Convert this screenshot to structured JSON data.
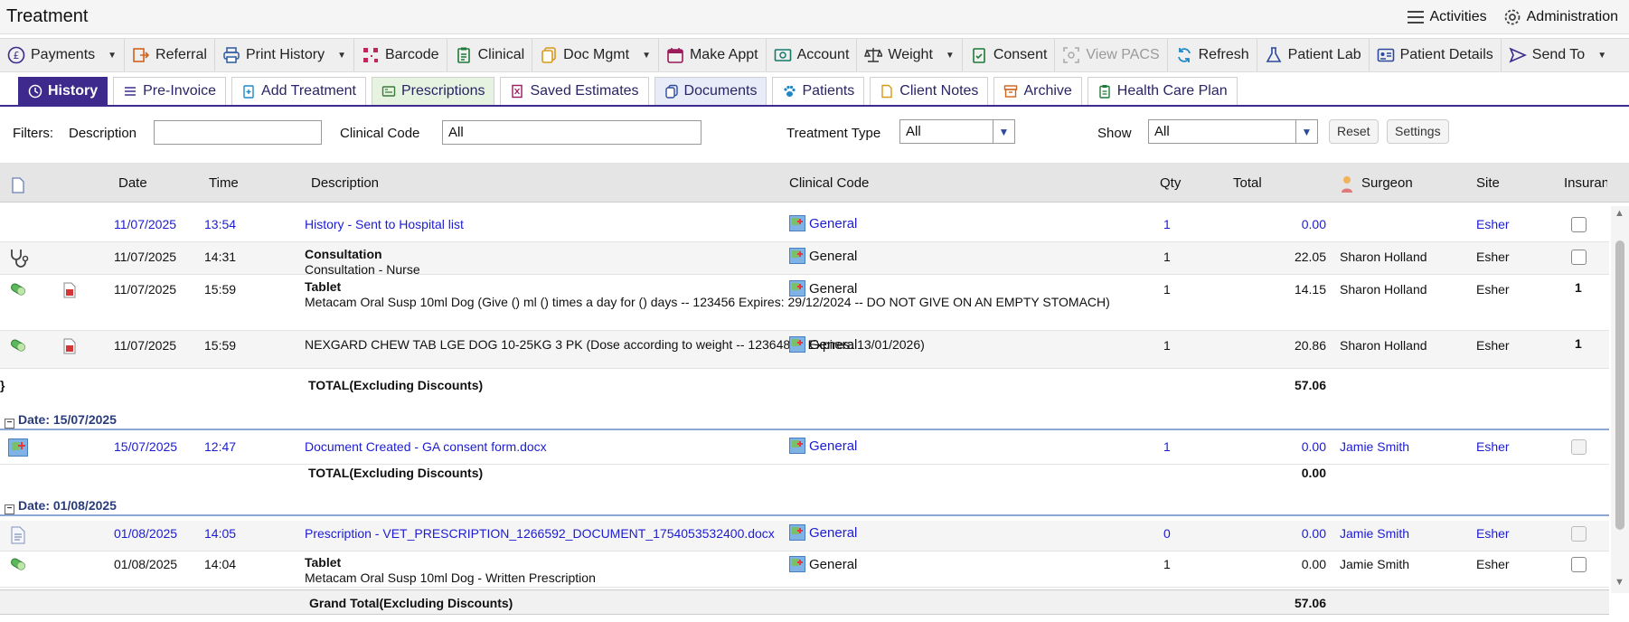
{
  "app": {
    "title": "Treatment",
    "top_actions": [
      {
        "label": "Activities",
        "icon": "list-icon"
      },
      {
        "label": "Administration",
        "icon": "gear-icon"
      }
    ]
  },
  "toolbar": [
    {
      "label": "Payments",
      "icon": "pound-icon",
      "dropdown": true
    },
    {
      "label": "Referral",
      "icon": "referral-icon"
    },
    {
      "label": "Print History",
      "icon": "printer-icon",
      "dropdown": true
    },
    {
      "label": "Barcode",
      "icon": "barcode-icon"
    },
    {
      "label": "Clinical",
      "icon": "clipboard-icon"
    },
    {
      "label": "Doc Mgmt",
      "icon": "documents-icon",
      "dropdown": true
    },
    {
      "label": "Make Appt",
      "icon": "calendar-icon"
    },
    {
      "label": "Account",
      "icon": "money-icon"
    },
    {
      "label": "Weight",
      "icon": "scales-icon",
      "dropdown": true
    },
    {
      "label": "Consent",
      "icon": "clipboard-check-icon"
    },
    {
      "label": "View PACS",
      "icon": "pacs-icon",
      "disabled": true
    },
    {
      "label": "Refresh",
      "icon": "refresh-icon"
    },
    {
      "label": "Patient Lab",
      "icon": "flask-icon"
    },
    {
      "label": "Patient Details",
      "icon": "id-card-icon"
    },
    {
      "label": "Send To",
      "icon": "send-icon",
      "dropdown": true
    }
  ],
  "tabs": [
    {
      "label": "History",
      "active": true
    },
    {
      "label": "Pre-Invoice"
    },
    {
      "label": "Add Treatment"
    },
    {
      "label": "Prescriptions"
    },
    {
      "label": "Saved Estimates"
    },
    {
      "label": "Documents"
    },
    {
      "label": "Patients"
    },
    {
      "label": "Client Notes"
    },
    {
      "label": "Archive"
    },
    {
      "label": "Health Care Plan"
    }
  ],
  "filters": {
    "label": "Filters:",
    "description_label": "Description",
    "description_value": "",
    "clinical_code_label": "Clinical Code",
    "clinical_code_value": "All",
    "treatment_type_label": "Treatment Type",
    "treatment_type_value": "All",
    "show_label": "Show",
    "show_value": "All",
    "reset_label": "Reset",
    "settings_label": "Settings"
  },
  "columns": {
    "date": "Date",
    "time": "Time",
    "description": "Description",
    "clinical_code": "Clinical Code",
    "qty": "Qty",
    "total": "Total",
    "surgeon": "Surgeon",
    "site": "Site",
    "insurance": "Insuranc"
  },
  "groups": [
    {
      "header": "",
      "rows": [
        {
          "date": "11/07/2025",
          "time": "13:54",
          "title": "History - Sent to Hospital list",
          "detail": "",
          "code": "General",
          "qty": "1",
          "total": "0.00",
          "surgeon": "",
          "site": "Esher",
          "insurance": "checkbox",
          "link": true
        },
        {
          "date": "11/07/2025",
          "time": "14:31",
          "title": "Consultation",
          "detail": "Consultation - Nurse",
          "code": "General",
          "qty": "1",
          "total": "22.05",
          "surgeon": "Sharon Holland",
          "site": "Esher",
          "insurance": "checkbox",
          "icon": "stethoscope-icon"
        },
        {
          "date": "11/07/2025",
          "time": "15:59",
          "title": "Tablet",
          "detail": "Metacam Oral Susp 10ml Dog (Give () ml () times a day for () days -- 123456 Expires: 29/12/2024 -- DO NOT GIVE ON AN EMPTY STOMACH)",
          "code": "General",
          "qty": "1",
          "total": "14.15",
          "surgeon": "Sharon Holland",
          "site": "Esher",
          "insurance": "1",
          "icon": "pill-icon"
        },
        {
          "date": "11/07/2025",
          "time": "15:59",
          "title": "",
          "detail": "NEXGARD CHEW TAB LGE DOG 10-25KG 3 PK (Dose according to weight -- 12364888 Expires: 13/01/2026)",
          "code": "General",
          "qty": "1",
          "total": "20.86",
          "surgeon": "Sharon Holland",
          "site": "Esher",
          "insurance": "1",
          "icon": "pill-icon"
        }
      ],
      "total_label": "TOTAL(Excluding Discounts)",
      "total_value": "57.06"
    },
    {
      "header": "Date: 15/07/2025",
      "rows": [
        {
          "date": "15/07/2025",
          "time": "12:47",
          "title": "Document Created - GA consent form.docx",
          "detail": "",
          "code": "General",
          "qty": "1",
          "total": "0.00",
          "surgeon": "Jamie Smith",
          "site": "Esher",
          "insurance": "checkbox",
          "link": true,
          "icon": "document-created-icon"
        }
      ],
      "total_label": "TOTAL(Excluding Discounts)",
      "total_value": "0.00"
    },
    {
      "header": "Date: 01/08/2025",
      "rows": [
        {
          "date": "01/08/2025",
          "time": "14:05",
          "title": "Prescription - VET_PRESCRIPTION_1266592_DOCUMENT_1754053532400.docx",
          "detail": "",
          "code": "General",
          "qty": "0",
          "total": "0.00",
          "surgeon": "Jamie Smith",
          "site": "Esher",
          "insurance": "checkbox",
          "link": true,
          "icon": "document-icon"
        },
        {
          "date": "01/08/2025",
          "time": "14:04",
          "title": "Tablet",
          "detail": "Metacam Oral Susp 10ml Dog - Written Prescription",
          "code": "General",
          "qty": "1",
          "total": "0.00",
          "surgeon": "Jamie Smith",
          "site": "Esher",
          "insurance": "checkbox",
          "icon": "pill-icon"
        }
      ]
    }
  ],
  "grand_total": {
    "label": "Grand Total(Excluding Discounts)",
    "value": "57.06"
  },
  "colors": {
    "accent": "#3d2a8c",
    "link": "#1c1cd1",
    "group": "#2a3c7a"
  }
}
